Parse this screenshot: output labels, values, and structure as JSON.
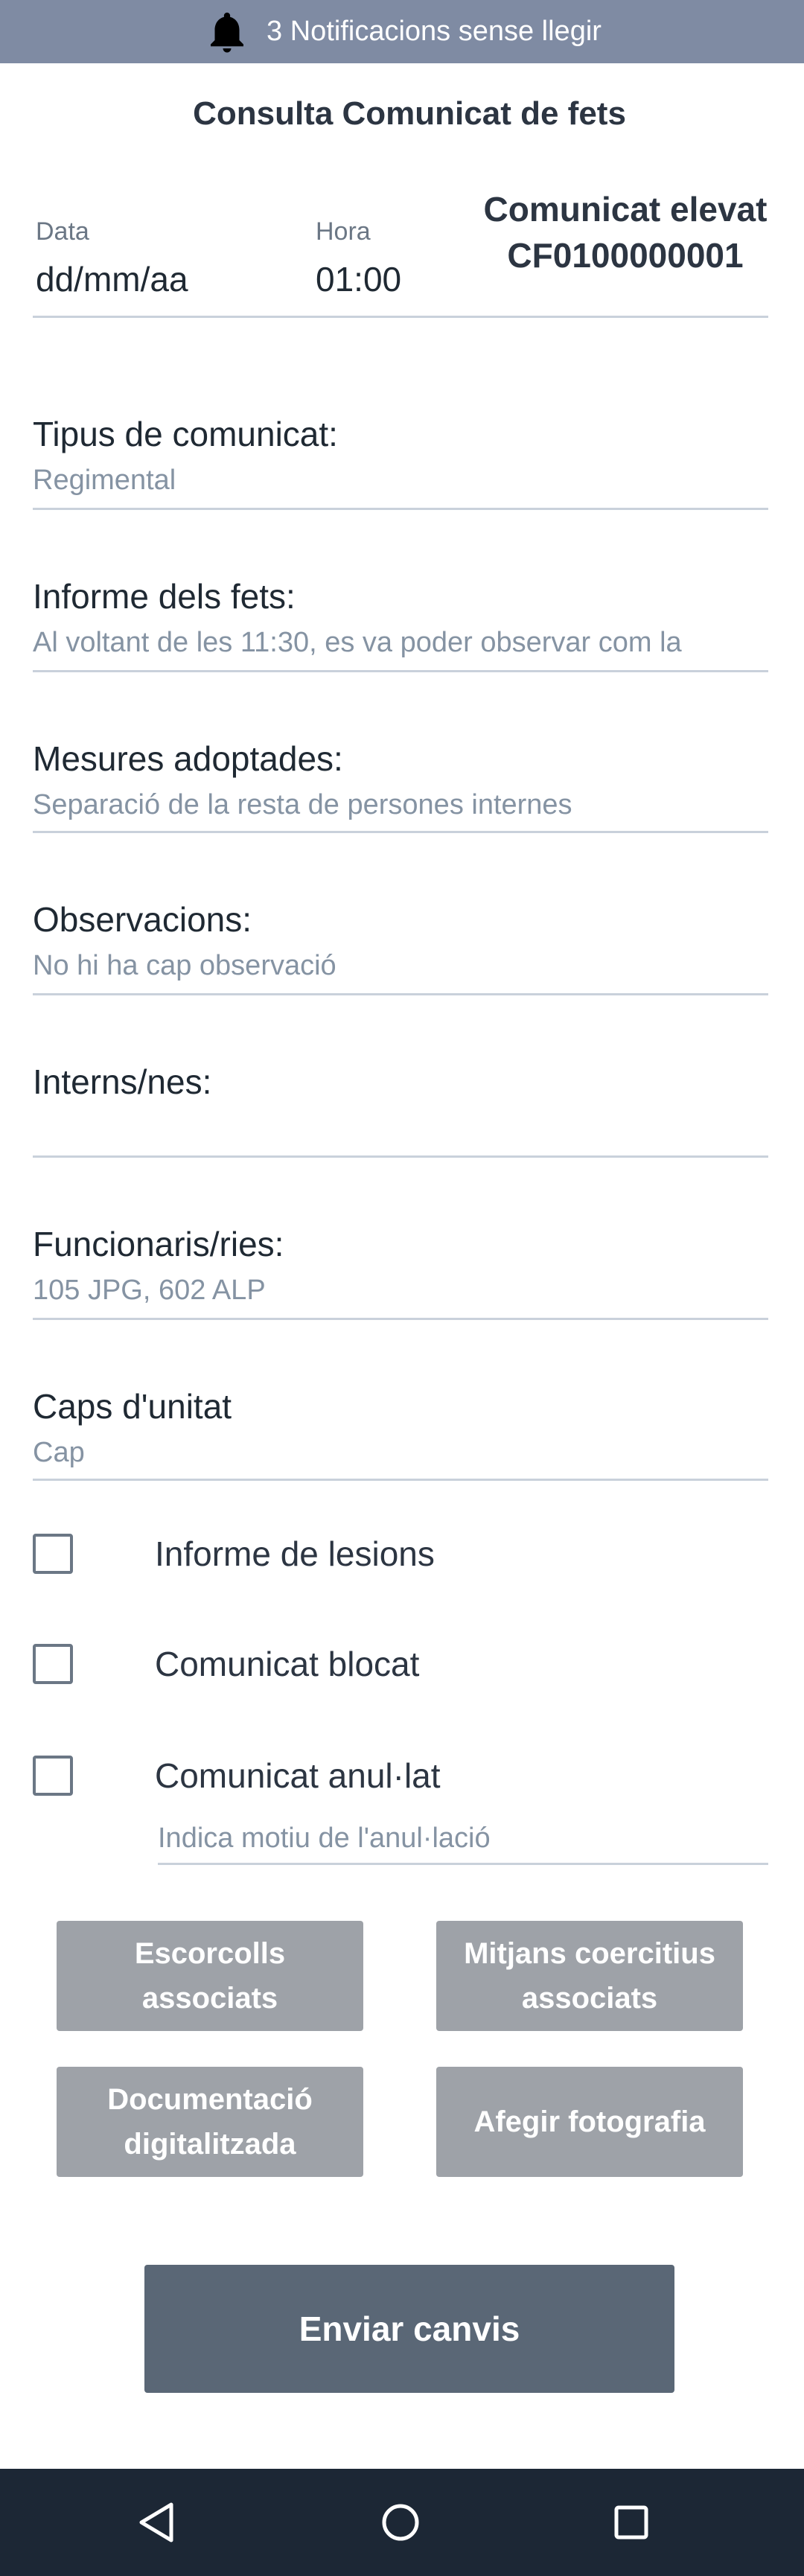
{
  "notification": {
    "text": "3 Notificacions sense llegir",
    "icon": "bell-icon"
  },
  "title": "Consulta Comunicat de fets",
  "header": {
    "data_label": "Data",
    "data_value": "dd/mm/aa",
    "hora_label": "Hora",
    "hora_value": "01:00",
    "comunicat_line1": "Comunicat elevat",
    "comunicat_line2": "CF0100000001"
  },
  "fields": [
    {
      "label": "Tipus de comunicat:",
      "value": "Regimental"
    },
    {
      "label": "Informe dels fets:",
      "value": "Al voltant de les 11:30, es va poder observar com la"
    },
    {
      "label": "Mesures adoptades:",
      "value": "Separació de la resta de persones internes"
    },
    {
      "label": "Observacions:",
      "value": "No hi ha cap observació"
    },
    {
      "label": "Interns/nes:",
      "value": ""
    },
    {
      "label": "Funcionaris/ries:",
      "value": "105 JPG, 602 ALP"
    },
    {
      "label": "Caps d'unitat",
      "value": "Cap"
    }
  ],
  "checks": [
    {
      "label": "Informe de lesions",
      "checked": false
    },
    {
      "label": "Comunicat blocat",
      "checked": false
    },
    {
      "label": "Comunicat anul·lat",
      "checked": false
    }
  ],
  "motiu_placeholder": "Indica motiu de l'anul·lació",
  "buttons": {
    "escorcolls": "Escorcolls associats",
    "mitjans": "Mitjans coercitius associats",
    "documentacio": "Documentació digitalitzada",
    "fotografia": "Afegir fotografia",
    "enviar": "Enviar canvis"
  },
  "colors": {
    "notification_bar": "#7f8ba3",
    "button_grey": "#9ea2a8",
    "button_primary": "#5a6776",
    "nav_bar": "#1c2735"
  },
  "nav": {
    "back": "back-triangle-icon",
    "home": "home-circle-icon",
    "recents": "recents-square-icon"
  }
}
